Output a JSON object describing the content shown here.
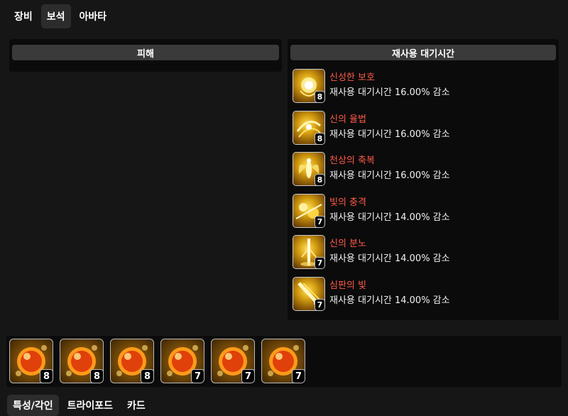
{
  "tabs": [
    {
      "label": "장비",
      "active": false
    },
    {
      "label": "보석",
      "active": true
    },
    {
      "label": "아바타",
      "active": false
    }
  ],
  "damage_panel": {
    "header": "피해"
  },
  "cooldown_panel": {
    "header": "재사용 대기시간",
    "gems": [
      {
        "name": "신성한 보호",
        "effect": "재사용 대기시간 16.00% 감소",
        "level": "8",
        "icon": "holy-protection-icon"
      },
      {
        "name": "신의 율법",
        "effect": "재사용 대기시간 16.00% 감소",
        "level": "8",
        "icon": "divine-law-icon"
      },
      {
        "name": "천상의 축복",
        "effect": "재사용 대기시간 16.00% 감소",
        "level": "8",
        "icon": "heavenly-blessing-icon"
      },
      {
        "name": "빛의 충격",
        "effect": "재사용 대기시간 14.00% 감소",
        "level": "7",
        "icon": "light-shock-icon"
      },
      {
        "name": "신의 분노",
        "effect": "재사용 대기시간 14.00% 감소",
        "level": "7",
        "icon": "divine-wrath-icon"
      },
      {
        "name": "심판의 빛",
        "effect": "재사용 대기시간 14.00% 감소",
        "level": "7",
        "icon": "light-of-judgment-icon"
      }
    ]
  },
  "gem_strip": [
    {
      "level": "8",
      "icon": "cooldown-gem-icon"
    },
    {
      "level": "8",
      "icon": "cooldown-gem-icon"
    },
    {
      "level": "8",
      "icon": "cooldown-gem-icon"
    },
    {
      "level": "7",
      "icon": "cooldown-gem-icon"
    },
    {
      "level": "7",
      "icon": "cooldown-gem-icon"
    },
    {
      "level": "7",
      "icon": "cooldown-gem-icon"
    }
  ],
  "bottom_tabs": [
    {
      "label": "특성/각인",
      "active": true
    },
    {
      "label": "트라이포드",
      "active": false
    },
    {
      "label": "카드",
      "active": false
    }
  ],
  "colors": {
    "gem_name": "#ff5a4a",
    "panel_header": "#3a3a3a",
    "background": "#161616",
    "gem_gold": "#d39c10"
  }
}
